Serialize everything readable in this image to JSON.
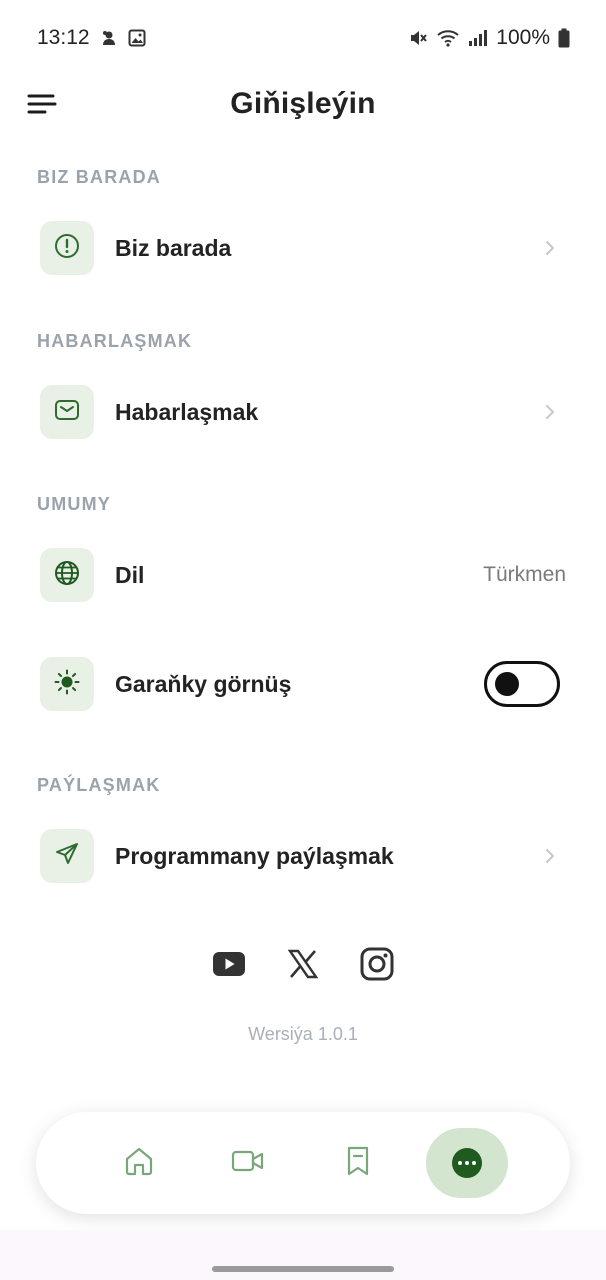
{
  "status_bar": {
    "time": "13:12",
    "battery": "100%",
    "icons": [
      "notification-icon",
      "gallery-icon",
      "mute-icon",
      "wifi-icon",
      "signal-icon",
      "battery-icon"
    ]
  },
  "header": {
    "title": "Giňişleýin",
    "menu_icon": "menu-icon"
  },
  "sections": {
    "about": {
      "title": "BIZ BARADA",
      "item_label": "Biz barada",
      "icon": "info-icon"
    },
    "contact": {
      "title": "HABARLAŞMAK",
      "item_label": "Habarlaşmak",
      "icon": "mail-icon"
    },
    "general": {
      "title": "UMUMY",
      "language_label": "Dil",
      "language_value": "Türkmen",
      "language_icon": "globe-icon",
      "dark_mode_label": "Garaňky görnüş",
      "dark_mode_icon": "sun-icon",
      "dark_mode_on": false
    },
    "share": {
      "title": "PAÝLAŞMAK",
      "item_label": "Programmany paýlaşmak",
      "icon": "send-icon"
    }
  },
  "socials": [
    "youtube-icon",
    "x-icon",
    "instagram-icon"
  ],
  "version": "Wersiýa 1.0.1",
  "bottom_nav": {
    "items": [
      "home-icon",
      "video-icon",
      "bookmark-icon",
      "more-icon"
    ],
    "active_index": 3
  },
  "colors": {
    "accent": "#1f5a1f",
    "icon_bg": "#e9f0e6",
    "section_title": "#9aa3ab",
    "active_nav_bg": "#d3e4cf"
  }
}
